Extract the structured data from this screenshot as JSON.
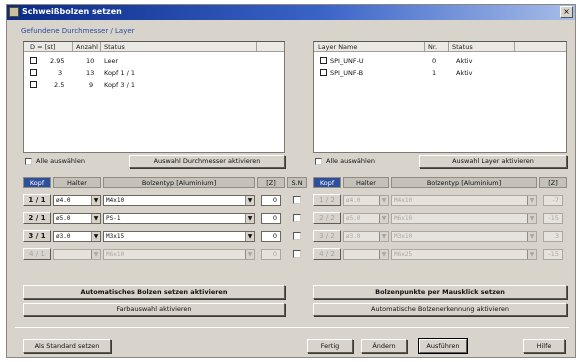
{
  "window": {
    "title": "Schweißbolzen setzen",
    "close_glyph": "×"
  },
  "left_group": {
    "label": "Gefundene Durchmesser / Layer",
    "columns": [
      "D = [st]",
      "Anzahl",
      "Status"
    ],
    "rows": [
      {
        "d": "2.95",
        "anzahl": "10",
        "status": "Leer"
      },
      {
        "d": "3",
        "anzahl": "13",
        "status": "Kopf 1 / 1"
      },
      {
        "d": "2.5",
        "anzahl": "9",
        "status": "Kopf 3 / 1"
      }
    ],
    "select_all": "Alle auswählen",
    "activate_button": "Auswahl Durchmesser aktivieren"
  },
  "right_group": {
    "columns": [
      "Layer Name",
      "Nr.",
      "Status"
    ],
    "rows": [
      {
        "name": "SPI_UNF-U",
        "nr": "0",
        "status": "Aktiv"
      },
      {
        "name": "SPI_UNF-B",
        "nr": "1",
        "status": "Aktiv"
      }
    ],
    "select_all": "Alle auswählen",
    "activate_button": "Auswahl Layer aktivieren"
  },
  "left_table": {
    "headers": {
      "kopf": "Kopf",
      "halter": "Halter",
      "bolzentyp": "Bolzentyp [Aluminium]",
      "z": "[Z]",
      "sn": "S.N"
    },
    "rows": [
      {
        "kopf": "1 / 1",
        "halter": "ø4.0",
        "bolzen": "M4x10",
        "z": "0"
      },
      {
        "kopf": "2 / 1",
        "halter": "ø5.0",
        "bolzen": "PS-1",
        "z": "0"
      },
      {
        "kopf": "3 / 1",
        "halter": "ø3.0",
        "bolzen": "M3x15",
        "z": "0"
      },
      {
        "kopf": "4 / 1",
        "halter": "",
        "bolzen": "M6x10",
        "z": "0"
      }
    ]
  },
  "right_table": {
    "headers": {
      "kopf": "Kopf",
      "halter": "Halter",
      "bolzentyp": "Bolzentyp [Aluminium]",
      "z": "[Z]"
    },
    "rows": [
      {
        "kopf": "1 / 2",
        "halter": "ø4.0",
        "bolzen": "M4x10",
        "z": "-7"
      },
      {
        "kopf": "2 / 2",
        "halter": "ø5.0",
        "bolzen": "M6x10",
        "z": "-15"
      },
      {
        "kopf": "3 / 2",
        "halter": "ø3.0",
        "bolzen": "M3x10",
        "z": "3"
      },
      {
        "kopf": "4 / 2",
        "halter": "",
        "bolzen": "M6x25",
        "z": "-15"
      }
    ]
  },
  "actions": {
    "auto_bolts": "Automatisches Bolzen setzen aktivieren",
    "color_select": "Farbauswahl aktivieren",
    "points_click": "Bolzenpunkte per Mausklick setzen",
    "auto_detect": "Automatische Bolzenerkennung aktivieren"
  },
  "footer": {
    "set_default": "Als Standard setzen",
    "done": "Fertig",
    "change": "Ändern",
    "execute": "Ausführen",
    "help": "Hilfe"
  }
}
